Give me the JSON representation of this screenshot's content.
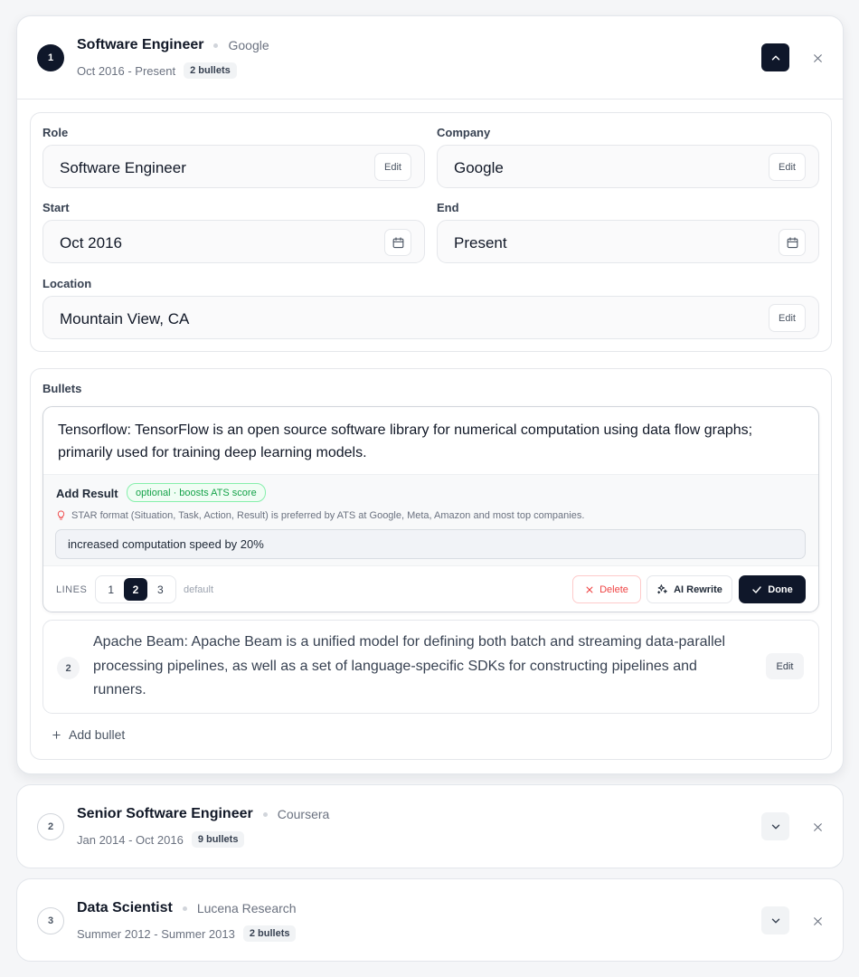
{
  "entries": [
    {
      "number": "1",
      "role": "Software Engineer",
      "company": "Google",
      "dates": "Oct 2016 - Present",
      "bullet_count": "2 bullets"
    },
    {
      "number": "2",
      "role": "Senior Software Engineer",
      "company": "Coursera",
      "dates": "Jan 2014 - Oct 2016",
      "bullet_count": "9 bullets"
    },
    {
      "number": "3",
      "role": "Data Scientist",
      "company": "Lucena Research",
      "dates": "Summer 2012 - Summer 2013",
      "bullet_count": "2 bullets"
    }
  ],
  "form": {
    "role_label": "Role",
    "role_value": "Software Engineer",
    "company_label": "Company",
    "company_value": "Google",
    "start_label": "Start",
    "start_value": "Oct 2016",
    "end_label": "End",
    "end_value": "Present",
    "location_label": "Location",
    "location_value": "Mountain View, CA",
    "edit_label": "Edit"
  },
  "bullets": {
    "section_label": "Bullets",
    "active_text": "Tensorflow:  TensorFlow is an open source software library for numerical computation using data flow graphs; primarily used for training deep learning models.",
    "add_result_label": "Add Result",
    "optional_badge": "optional · boosts ATS score",
    "star_hint": "STAR format (Situation, Task, Action, Result) is preferred by ATS at Google, Meta, Amazon and most top companies.",
    "result_value": "increased computation speed by 20%",
    "lines_label": "LINES",
    "line_options": [
      "1",
      "2",
      "3"
    ],
    "lines_selected": "2",
    "default_label": "default",
    "delete_label": "Delete",
    "ai_rewrite_label": "AI Rewrite",
    "done_label": "Done",
    "second_number": "2",
    "second_text": "Apache Beam: Apache Beam is a unified model for defining both batch and streaming data-parallel processing pipelines, as well as a set of language-specific SDKs for constructing pipelines and runners.",
    "second_edit": "Edit",
    "add_bullet_label": "Add bullet"
  },
  "colors": {
    "primary_dark": "#0f172a",
    "danger": "#ef4444",
    "success": "#16a34a"
  },
  "icons": {
    "collapse": "chevron-up-icon",
    "expand": "chevron-down-icon",
    "remove": "close-icon",
    "date": "calendar-icon",
    "hint": "lightbulb-icon",
    "delete": "x-icon",
    "ai": "sparkle-icon",
    "done": "check-icon",
    "add": "plus-icon"
  }
}
